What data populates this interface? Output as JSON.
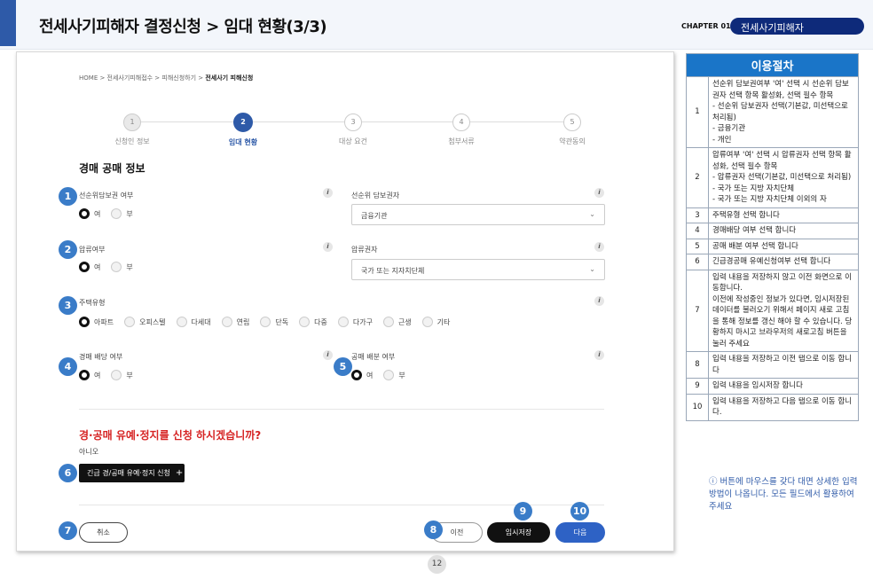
{
  "header": {
    "title": "전세사기피해자 결정신청 > 임대 현황(3/3)",
    "chapter": "CHAPTER 01",
    "chapter_title": "전세사기피해자"
  },
  "breadcrumb": {
    "path": "HOME > 전세사기피해접수 > 피해신청하기 > ",
    "current": "전세사기 피해신청"
  },
  "steps": [
    {
      "num": "1",
      "label": "신청인 정보"
    },
    {
      "num": "2",
      "label": "임대 현황"
    },
    {
      "num": "3",
      "label": "대상 요건"
    },
    {
      "num": "4",
      "label": "첨부서류"
    },
    {
      "num": "5",
      "label": "약관동의"
    }
  ],
  "section_title": "경매 공매 정보",
  "fields": {
    "senior_mortgage": {
      "label": "선순위담보권 여부",
      "yes": "여",
      "no": "부"
    },
    "senior_mortgage_holder": {
      "label": "선순위 담보권자",
      "value": "금융기관"
    },
    "seizure": {
      "label": "압류여부",
      "yes": "여",
      "no": "부"
    },
    "seizure_holder": {
      "label": "압류권자",
      "value": "국가 또는 지자치단체"
    },
    "housing_type": {
      "label": "주택유형",
      "options": [
        "아파트",
        "오피스텔",
        "다세대",
        "연립",
        "단독",
        "다중",
        "다가구",
        "근생",
        "기타"
      ]
    },
    "auction_dividend": {
      "label": "경매 배당 여부",
      "yes": "여",
      "no": "부"
    },
    "public_sale_dividend": {
      "label": "공매 배분 여부",
      "yes": "여",
      "no": "부"
    }
  },
  "question": "경·공매 유예·정지를 신청 하시겠습니까?",
  "answer": "아니오",
  "urgent_button": "긴급 경/공매 유예·정지 신청",
  "buttons": {
    "cancel": "취소",
    "prev": "이전",
    "temp_save": "임시저장",
    "next": "다음"
  },
  "badges": [
    "1",
    "2",
    "3",
    "4",
    "5",
    "6",
    "7",
    "8",
    "9",
    "10"
  ],
  "page_number": "12",
  "procedure": {
    "title": "이용절차",
    "rows": [
      {
        "num": "1",
        "text": "선순위 담보권여부 '여' 선택 시 선순위 담보권자 선택 항목 활성화, 선택 필수 항목\n- 선순위 담보권자 선택(기본값, 미선택으로 처리됨)\n- 금융기관\n- 개인"
      },
      {
        "num": "2",
        "text": "압류여부 '여' 선택 시 압류권자 선택 항목 활성화, 선택 필수 항목\n- 압류권자 선택(기본값, 미선택으로 처리됨)\n- 국가 또는 지방 자치단체\n- 국가 또는 지방 자치단체 이외의 자"
      },
      {
        "num": "3",
        "text": "주택유형 선택 합니다"
      },
      {
        "num": "4",
        "text": "경매배당 여부 선택 합니다"
      },
      {
        "num": "5",
        "text": "공매 배분 여부 선택 합니다"
      },
      {
        "num": "6",
        "text": "긴급경공매 유예신청여부 선택 합니다"
      },
      {
        "num": "7",
        "text": "입력 내용을 저장하지 않고 이전 화면으로  이동합니다.\n이전에 작성중인 정보가 있다면, 임시저장된 데이터를 불러오기 위해서 페이지 새로 고침을 통해 정보를 갱신 해야 할 수 있습니다. 당황하지 마시고 브라우저의 새로고침 버튼을 눌러 주세요"
      },
      {
        "num": "8",
        "text": "입력 내용을 저장하고 이전 탭으로 이동 합니다"
      },
      {
        "num": "9",
        "text": "입력 내용을 임시저장 합니다"
      },
      {
        "num": "10",
        "text": "입력 내용을 저장하고 다음 탭으로 이동 합니다."
      }
    ],
    "note": "ⓘ 버튼에 마우스를 갖다 대면 상세한 입력 방법이 나옵니다. 모든 필드에서 활용하여 주세요"
  }
}
